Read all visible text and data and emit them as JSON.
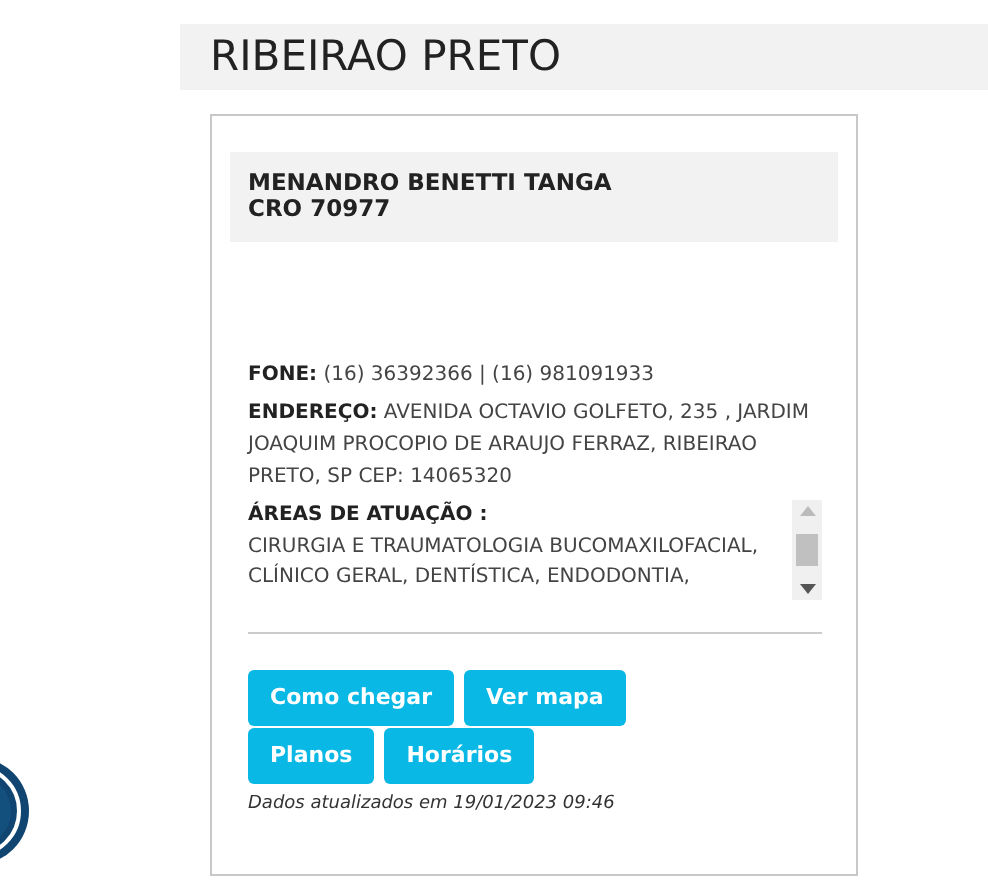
{
  "city_title": "RIBEIRAO PRETO",
  "dentist": {
    "name": "MENANDRO BENETTI TANGA",
    "registration": "CRO 70977"
  },
  "phone": {
    "label": "FONE:",
    "value": "(16) 36392366 | (16) 981091933"
  },
  "address": {
    "label": "ENDEREÇO:",
    "value": "AVENIDA OCTAVIO GOLFETO, 235 , JARDIM JOAQUIM PROCOPIO DE ARAUJO FERRAZ, RIBEIRAO PRETO, SP CEP: 14065320"
  },
  "areas": {
    "label": "ÁREAS DE ATUAÇÃO :",
    "value": "CIRURGIA E TRAUMATOLOGIA BUCOMAXILOFACIAL, CLÍNICO GERAL, DENTÍSTICA, ENDODONTIA,"
  },
  "buttons": [
    "Como chegar",
    "Ver mapa",
    "Planos",
    "Horários"
  ],
  "updated": "Dados atualizados em 19/01/2023 09:46"
}
